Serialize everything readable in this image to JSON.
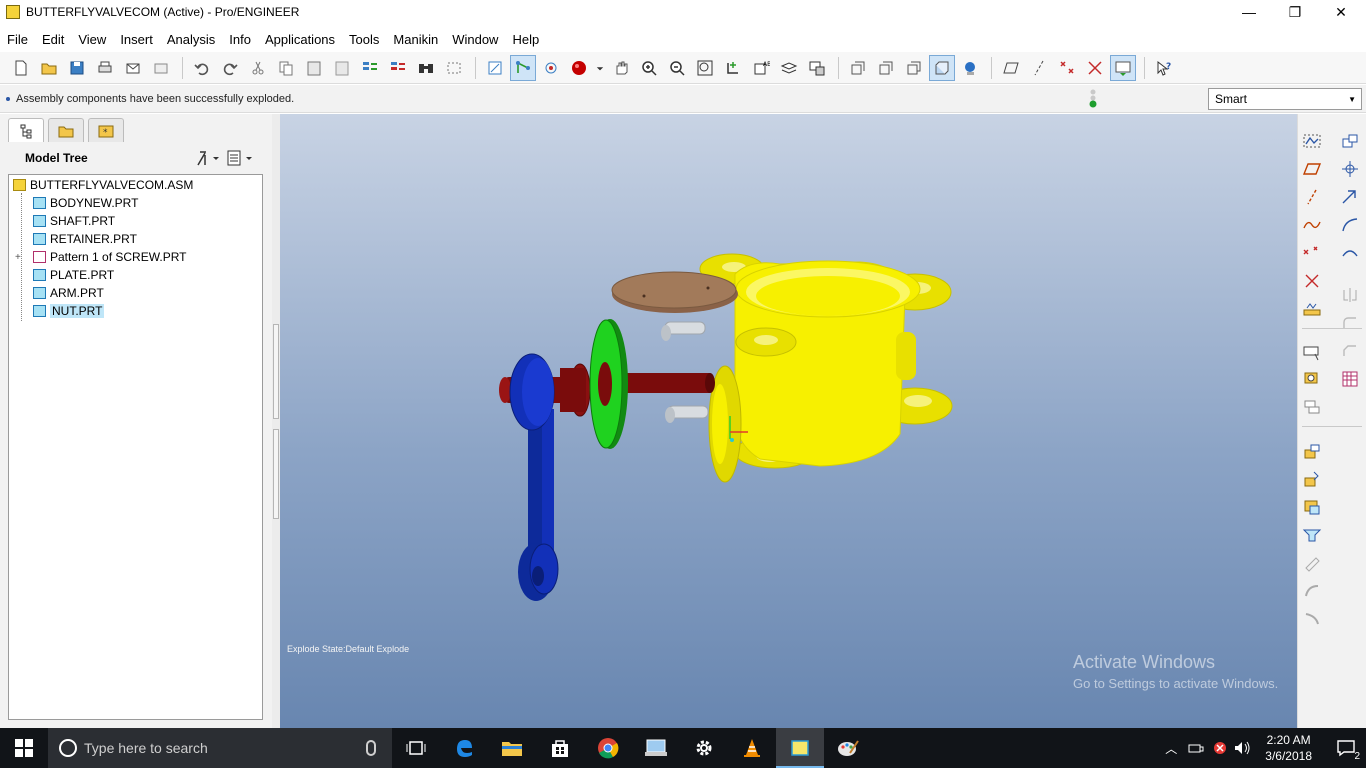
{
  "window": {
    "title": "BUTTERFLYVALVECOM (Active) - Pro/ENGINEER",
    "minimize": "—",
    "maximize": "❐",
    "close": "✕"
  },
  "menu": [
    "File",
    "Edit",
    "View",
    "Insert",
    "Analysis",
    "Info",
    "Applications",
    "Tools",
    "Manikin",
    "Window",
    "Help"
  ],
  "status": {
    "message": "Assembly components have been successfully exploded.",
    "filter": "Smart"
  },
  "model_tree": {
    "title": "Model Tree",
    "root": "BUTTERFLYVALVECOM.ASM",
    "items": [
      {
        "label": "BODYNEW.PRT",
        "icon": "part-icon"
      },
      {
        "label": "SHAFT.PRT",
        "icon": "part-icon"
      },
      {
        "label": "RETAINER.PRT",
        "icon": "part-icon"
      },
      {
        "label": "Pattern 1 of SCREW.PRT",
        "icon": "pattern-icon"
      },
      {
        "label": "PLATE.PRT",
        "icon": "part-icon"
      },
      {
        "label": "ARM.PRT",
        "icon": "part-icon"
      },
      {
        "label": "NUT.PRT",
        "icon": "part-icon",
        "selected": true
      }
    ],
    "expand_glyph": "+"
  },
  "viewport": {
    "explode_state": "Explode State:Default Explode",
    "model_colors": {
      "body": "#f7f000",
      "retainer": "#1fd21f",
      "shaft": "#7a0c0c",
      "arm": "#1230b8",
      "plate": "#a27a5a",
      "screw": "#d8dce0"
    }
  },
  "watermark": {
    "line1": "Activate Windows",
    "line2": "Go to Settings to activate Windows."
  },
  "taskbar": {
    "search_placeholder": "Type here to search",
    "time": "2:20 AM",
    "date": "3/6/2018",
    "notifications": "2"
  }
}
